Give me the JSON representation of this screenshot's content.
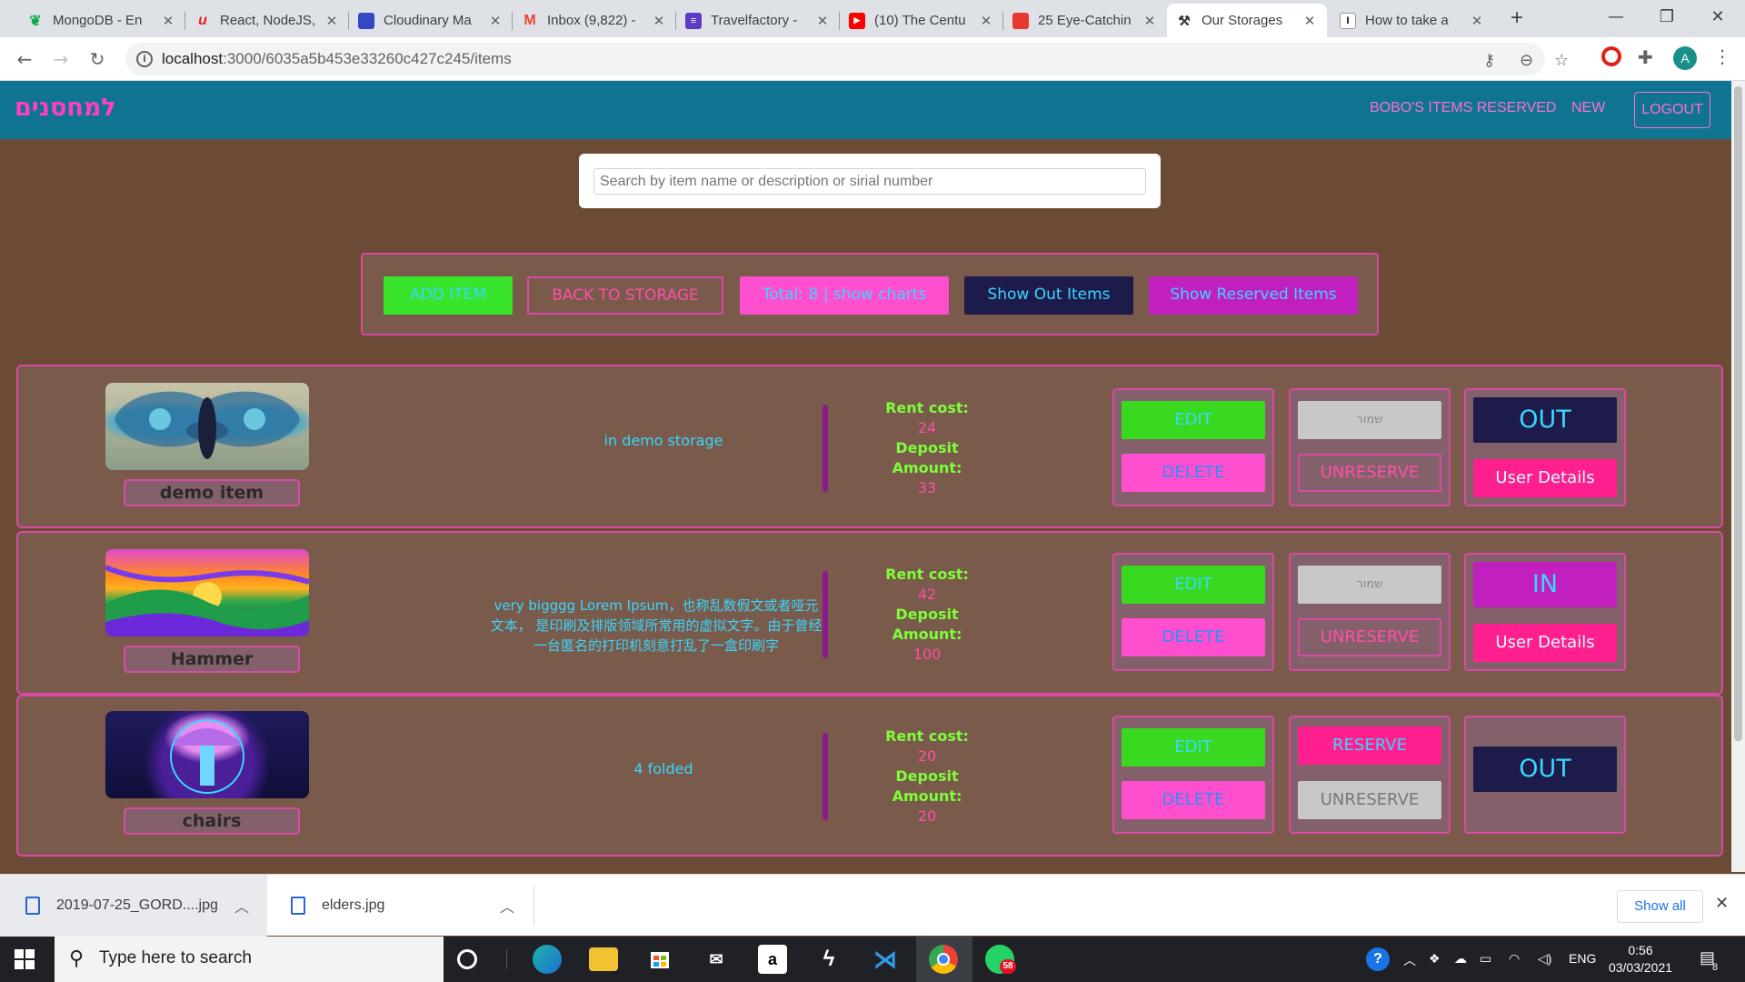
{
  "browser": {
    "tabs": [
      {
        "title": "MongoDB - En",
        "fav_color": "#13aa52",
        "fav_glyph": ""
      },
      {
        "title": "React, NodeJS,",
        "fav_color": "#e2231a",
        "fav_glyph": "u"
      },
      {
        "title": "Cloudinary Ma",
        "fav_color": "#3448c5",
        "fav_glyph": ""
      },
      {
        "title": "Inbox (9,822) -",
        "fav_color": "#ea4335",
        "fav_glyph": "M"
      },
      {
        "title": "Travelfactory - ",
        "fav_color": "#5b3cc4",
        "fav_glyph": "≡"
      },
      {
        "title": "(10) The Centu",
        "fav_color": "#ff0000",
        "fav_glyph": "▶"
      },
      {
        "title": "25 Eye-Catchin",
        "fav_color": "#e8382f",
        "fav_glyph": ""
      },
      {
        "title": "Our Storages",
        "fav_color": "#555555",
        "fav_glyph": "⚒"
      },
      {
        "title": "How to take a",
        "fav_color": "#ffffff",
        "fav_glyph": "I"
      }
    ],
    "close_glyph": "✕",
    "newtab_glyph": "+",
    "window_controls": {
      "minimize": "—",
      "maximize": "❐",
      "close": "✕"
    },
    "url_host": "localhost",
    "url_path": ":3000/6035a5b453e33260c427c245/items",
    "avatar_letter": "A",
    "icons": [
      "key-icon",
      "zoom-icon",
      "star-icon",
      "opera-icon",
      "extensions-icon",
      "menu-icon"
    ]
  },
  "app": {
    "brand": "למחסנים",
    "nav": {
      "reserved": "BOBO'S ITEMS RESERVED",
      "new": "NEW",
      "logout": "LOGOUT"
    },
    "search": {
      "placeholder": "Search by item name or description or sirial number"
    },
    "actions": {
      "add_item": "ADD ITEM",
      "back_to_storage": "BACK TO STORAGE",
      "total": "Total: 8 | show charts",
      "show_out": "Show Out Items",
      "show_reserved": "Show Reserved Items"
    },
    "labels": {
      "rent_cost": "Rent cost:",
      "deposit": "Deposit",
      "amount": "Amount:",
      "edit": "EDIT",
      "delete": "DELETE",
      "keep": "שמור",
      "reserve": "RESERVE",
      "unreserve": "UNRESERVE",
      "user_details": "User Details"
    },
    "items": [
      {
        "name": "demo item",
        "description": "in demo storage",
        "rent": "24",
        "deposit": "33",
        "status": "OUT"
      },
      {
        "name": "Hammer",
        "description": "very bigggg Lorem Ipsum，也称乱数假文或者哑元文本， 是印刷及排版领域所常用的虚拟文字。由于曾经一台匿名的打印机刻意打乱了一盒印刷字",
        "rent": "42",
        "deposit": "100",
        "status": "IN"
      },
      {
        "name": "chairs",
        "description": "4 folded",
        "rent": "20",
        "deposit": "20",
        "status": "OUT"
      }
    ]
  },
  "downloads": {
    "files": [
      "2019-07-25_GORD....jpg",
      "elders.jpg"
    ],
    "show_all": "Show all",
    "close_glyph": "✕"
  },
  "taskbar": {
    "search_placeholder": "Type here to search",
    "language": "ENG",
    "time": "0:56",
    "date": "03/03/2021",
    "notification_count": "8",
    "whatsapp_badge": "58"
  }
}
